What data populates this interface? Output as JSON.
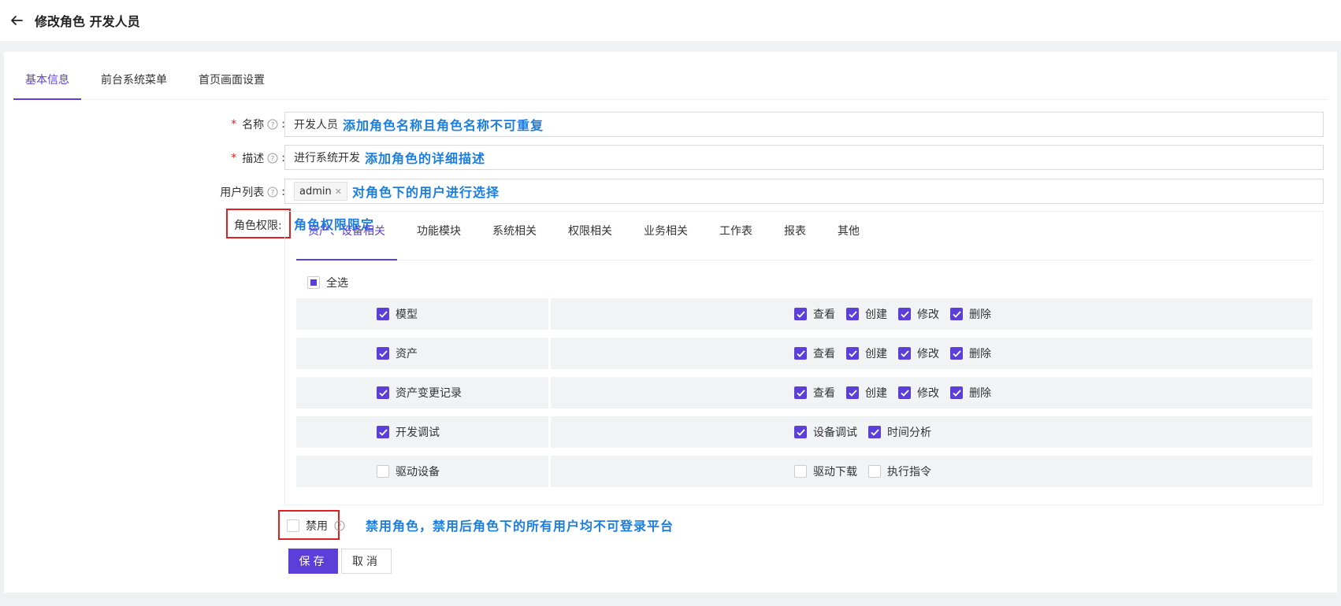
{
  "header": {
    "title": "修改角色 开发人员"
  },
  "tabs": [
    "基本信息",
    "前台系统菜单",
    "首页画面设置"
  ],
  "form": {
    "name": {
      "label": "名称",
      "value": "开发人员",
      "note": "添加角色名称且角色名称不可重复"
    },
    "desc": {
      "label": "描述",
      "value": "进行系统开发",
      "note": "添加角色的详细描述"
    },
    "users": {
      "label": "用户列表",
      "tag": "admin",
      "note": "对角色下的用户进行选择"
    },
    "perm": {
      "label": "角色权限:",
      "note": "角色权限限定"
    }
  },
  "perm_tabs": [
    "资产、设备相关",
    "功能模块",
    "系统相关",
    "权限相关",
    "业务相关",
    "工作表",
    "报表",
    "其他"
  ],
  "select_all": "全选",
  "perm_rows": [
    {
      "name": "模型",
      "checked": true,
      "ops": [
        {
          "l": "查看",
          "c": true
        },
        {
          "l": "创建",
          "c": true
        },
        {
          "l": "修改",
          "c": true
        },
        {
          "l": "删除",
          "c": true
        }
      ]
    },
    {
      "name": "资产",
      "checked": true,
      "ops": [
        {
          "l": "查看",
          "c": true
        },
        {
          "l": "创建",
          "c": true
        },
        {
          "l": "修改",
          "c": true
        },
        {
          "l": "删除",
          "c": true
        }
      ]
    },
    {
      "name": "资产变更记录",
      "checked": true,
      "ops": [
        {
          "l": "查看",
          "c": true
        },
        {
          "l": "创建",
          "c": true
        },
        {
          "l": "修改",
          "c": true
        },
        {
          "l": "删除",
          "c": true
        }
      ]
    },
    {
      "name": "开发调试",
      "checked": true,
      "ops": [
        {
          "l": "设备调试",
          "c": true
        },
        {
          "l": "时间分析",
          "c": true
        }
      ]
    },
    {
      "name": "驱动设备",
      "checked": false,
      "ops": [
        {
          "l": "驱动下载",
          "c": false
        },
        {
          "l": "执行指令",
          "c": false
        }
      ]
    }
  ],
  "disable": {
    "label": "禁用",
    "note": "禁用角色，禁用后角色下的所有用户均不可登录平台"
  },
  "buttons": {
    "save": "保存",
    "cancel": "取消"
  },
  "colors": {
    "accent": "#5b3fd8",
    "note": "#1a7de0",
    "highlight": "#e02020"
  }
}
